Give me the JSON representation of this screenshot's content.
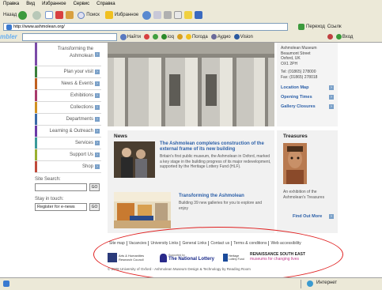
{
  "browser": {
    "menu": [
      "Правка",
      "Вид",
      "Избранное",
      "Сервис",
      "Справка"
    ],
    "toolbar": {
      "back_label": "Назад",
      "search_label": "Поиск",
      "favorites_label": "Избранное"
    },
    "address": {
      "url": "http://www.ashmolean.org/",
      "go_label": "Переход",
      "links_label": "Ссылк"
    },
    "google_bar": {
      "brand": "mbler",
      "search_button": "Найти",
      "items": [
        "ioq",
        "Погода",
        "Аудио",
        "Vision"
      ],
      "login_label": "Вход"
    }
  },
  "address_block": [
    "Ashmolean Museum",
    "Beaumont Street",
    "Oxford, UK",
    "OX1 2PH",
    "Tel: (01865) 278000",
    "Fax: (01865) 278018"
  ],
  "hero_links": [
    "Location Map",
    "Opening Times",
    "Gallery Closures"
  ],
  "sidebar": {
    "items": [
      {
        "label": "Transforming the Ashmolean",
        "color": "#7b4aa8"
      },
      {
        "label": "Plan your visit",
        "color": "#3a7f3a"
      },
      {
        "label": "News & Events",
        "color": "#c06020"
      },
      {
        "label": "Exhibitions",
        "color": "#a83a6a"
      },
      {
        "label": "Collections",
        "color": "#d09020"
      },
      {
        "label": "Departments",
        "color": "#3a6aa8"
      },
      {
        "label": "Learning & Outreach",
        "color": "#6a3aa8"
      },
      {
        "label": "Services",
        "color": "#3a9a9a"
      },
      {
        "label": "Support Us",
        "color": "#9ab030"
      },
      {
        "label": "Shop",
        "color": "#c04a3a"
      }
    ]
  },
  "forms": {
    "search_label": "Site Search:",
    "search_value": "",
    "stay_label": "Stay in touch:",
    "stay_value": "Register for e-news",
    "go_label": "GO"
  },
  "news": {
    "title": "News",
    "item1_title": "The Ashmolean completes construction of the external frame of its new building",
    "item1_body": "Britain's first public museum, the Ashmolean in Oxford, marked a key stage in the building progress of its major redevelopment, supported by the Heritage Lottery Fund (HLF).",
    "item2_title": "Transforming the Ashmolean",
    "item2_body": "Building 39 new galleries for you to explore and enjoy"
  },
  "treasures": {
    "title": "Treasures",
    "caption": "An exhibition of the Ashmolean's Treasures",
    "link": "Find Out More"
  },
  "footer": {
    "links": [
      "Site map",
      "Vacancies",
      "University Links",
      "General Links",
      "Contact us",
      "Terms & conditions",
      "Web accessibility"
    ],
    "logo_ahrc": "Arts & Humanities Research Council",
    "logo_lottery": "The National Lottery",
    "logo_lottery_small": "Supported by",
    "logo_hlf": "Heritage Lottery Fund",
    "logo_renaissance": "RENAISSANCE SOUTH EAST",
    "logo_renaissance_sub": "museums for changing lives",
    "copyright": "© 2008 University of Oxford - Ashmolean Museum Design & Technology by Reading Room"
  },
  "status": {
    "zone": "Интернет"
  }
}
